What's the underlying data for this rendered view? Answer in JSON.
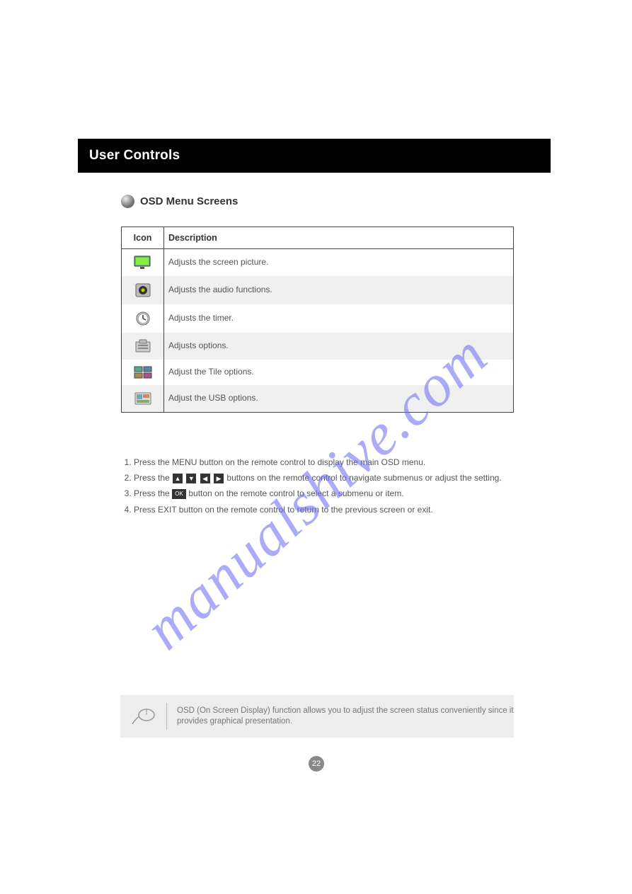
{
  "header": {
    "title": "User Controls"
  },
  "section": {
    "title": "OSD Menu Screens"
  },
  "table": {
    "headers": {
      "icon": "Icon",
      "description": "Description"
    },
    "rows": [
      {
        "icon": "picture",
        "text": "Adjusts the screen picture."
      },
      {
        "icon": "audio",
        "text": "Adjusts the audio functions."
      },
      {
        "icon": "timer",
        "text": "Adjusts the timer."
      },
      {
        "icon": "option",
        "text": "Adjusts options."
      },
      {
        "icon": "tile",
        "text": "Adjust the Tile options."
      },
      {
        "icon": "usb",
        "text": "Adjust the USB options."
      }
    ]
  },
  "instructions": {
    "items": [
      "Press the MENU button on the remote control to display the main OSD menu.",
      "Press the Up / Down / Left / Right buttons on the remote control to navigate submenus or adjust the setting.",
      "Press the OK button on the remote control to select a submenu or item.",
      "Press EXIT button on the remote control to return to the previous screen or exit."
    ]
  },
  "note": {
    "text": "OSD (On Screen Display) function allows you to adjust the screen status conveniently since it provides graphical presentation."
  },
  "page_number": "22",
  "watermark": "manualshive.com"
}
